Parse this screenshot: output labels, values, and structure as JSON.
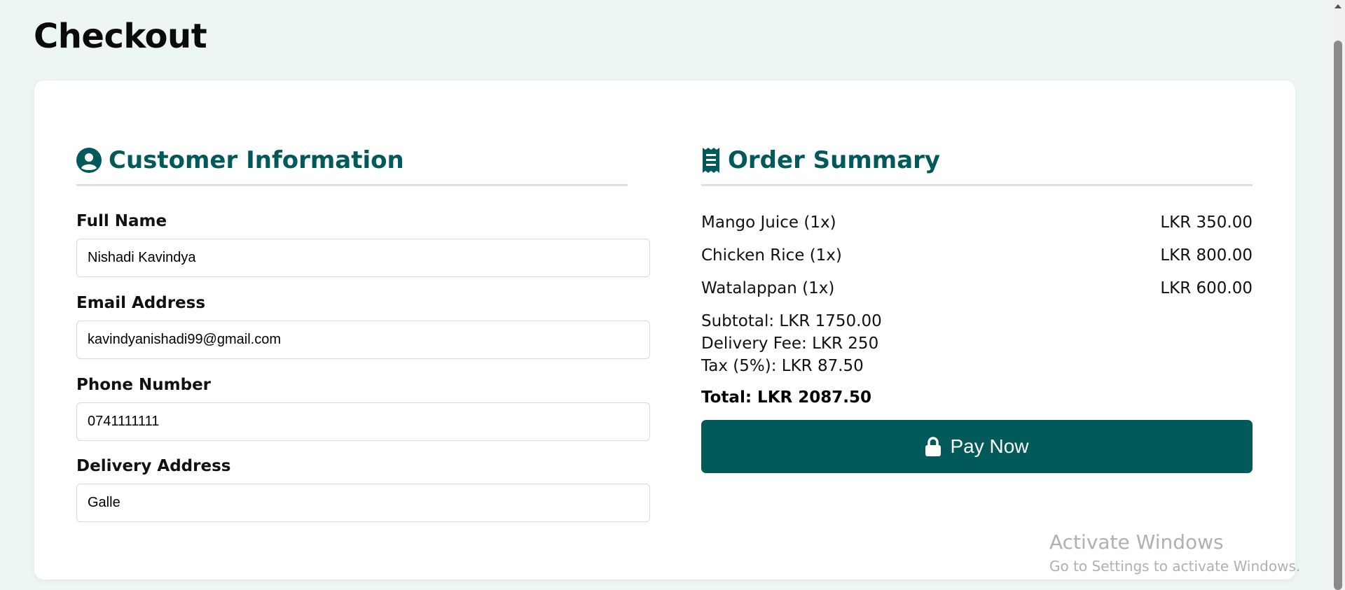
{
  "page": {
    "title": "Checkout"
  },
  "customer": {
    "heading": "Customer Information",
    "fields": [
      {
        "label": "Full Name",
        "value": "Nishadi Kavindya"
      },
      {
        "label": "Email Address",
        "value": "kavindyanishadi99@gmail.com"
      },
      {
        "label": "Phone Number",
        "value": "0741111111"
      },
      {
        "label": "Delivery Address",
        "value": "Galle"
      }
    ]
  },
  "order": {
    "heading": "Order Summary",
    "items": [
      {
        "name": "Mango Juice (1x)",
        "price": "LKR 350.00"
      },
      {
        "name": "Chicken Rice (1x)",
        "price": "LKR 800.00"
      },
      {
        "name": "Watalappan (1x)",
        "price": "LKR 600.00"
      }
    ],
    "subtotal": "Subtotal: LKR 1750.00",
    "delivery_fee": "Delivery Fee: LKR 250",
    "tax": "Tax (5%): LKR 87.50",
    "total": "Total: LKR 2087.50",
    "pay_label": "Pay Now"
  },
  "watermark": {
    "title": "Activate Windows",
    "subtitle": "Go to Settings to activate Windows."
  },
  "icons": {
    "customer": "user-circle-icon",
    "order": "receipt-icon",
    "pay": "lock-icon"
  },
  "colors": {
    "accent": "#02595a",
    "background": "#eef6f5",
    "card": "#ffffff"
  }
}
